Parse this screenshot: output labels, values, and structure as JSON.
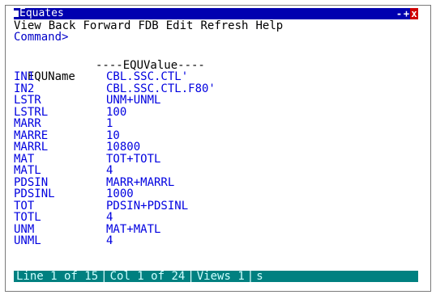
{
  "window": {
    "title": "Equates",
    "controls": {
      "minimize": "-",
      "maximize": "+",
      "close": "x"
    }
  },
  "menu": {
    "items": [
      "View",
      "Back",
      "Forward",
      "FDB",
      "Edit",
      "Refresh",
      "Help"
    ]
  },
  "command": {
    "prompt": "Command>"
  },
  "table": {
    "headers": {
      "name": "EQUName",
      "value": "----EQUValue----"
    },
    "rows": [
      {
        "name": "IN1",
        "value": "CBL.SSC.CTL'"
      },
      {
        "name": "IN2",
        "value": "CBL.SSC.CTL.F80'"
      },
      {
        "name": "LSTR",
        "value": "UNM+UNML"
      },
      {
        "name": "LSTRL",
        "value": "100"
      },
      {
        "name": "MARR",
        "value": "1"
      },
      {
        "name": "MARRE",
        "value": "10"
      },
      {
        "name": "MARRL",
        "value": "10800"
      },
      {
        "name": "MAT",
        "value": "TOT+TOTL"
      },
      {
        "name": "MATL",
        "value": "4"
      },
      {
        "name": "PDSIN",
        "value": "MARR+MARRL"
      },
      {
        "name": "PDSINL",
        "value": "1000"
      },
      {
        "name": "TOT",
        "value": "PDSIN+PDSINL"
      },
      {
        "name": "TOTL",
        "value": "4"
      },
      {
        "name": "UNM",
        "value": "MAT+MATL"
      },
      {
        "name": "UNML",
        "value": "4"
      }
    ]
  },
  "status": {
    "line": "Line 1 of 15",
    "col": "Col 1 of 24",
    "views": "Views 1",
    "extra": "s",
    "separator": "|"
  },
  "colors": {
    "titlebar_bg": "#0000b0",
    "close_bg": "#d00000",
    "data_text": "#0000e0",
    "statusbar_bg": "#008080"
  }
}
